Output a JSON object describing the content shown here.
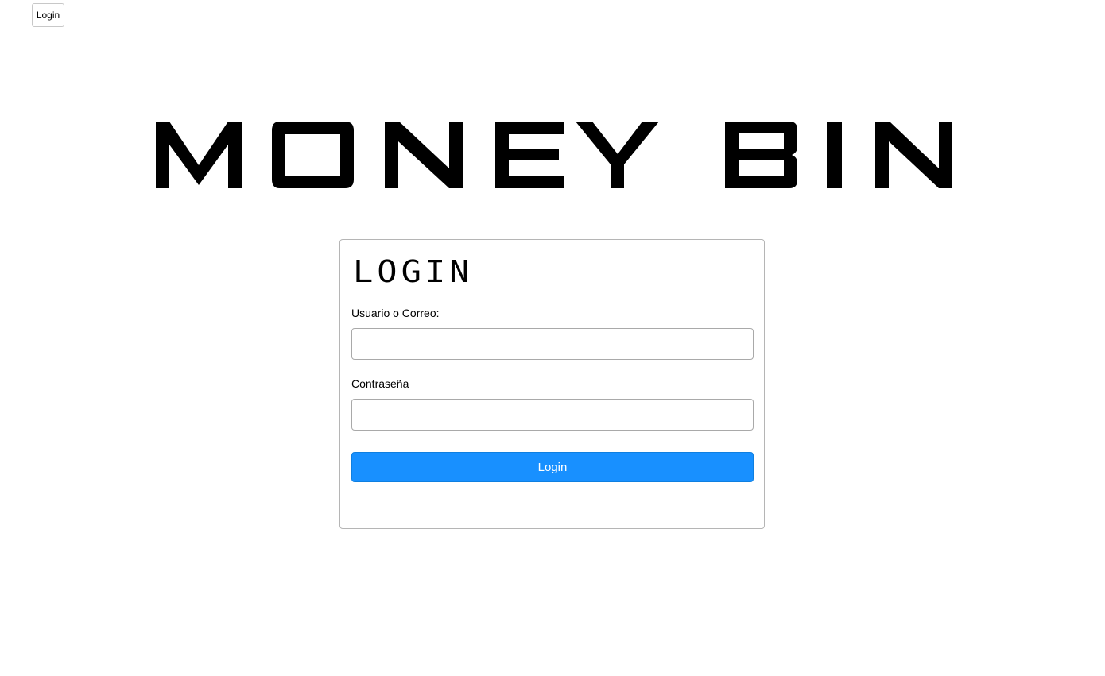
{
  "nav": {
    "login_label": "Login"
  },
  "logo": {
    "text": "MONEY BIN"
  },
  "login_card": {
    "title": "LOGIN",
    "user_label": "Usuario o Correo:",
    "user_value": "",
    "password_label": "Contraseña",
    "password_value": "",
    "submit_label": "Login"
  },
  "colors": {
    "accent": "#1890ff",
    "border": "#b5b5b5",
    "background": "#ffffff",
    "text": "#000000"
  }
}
